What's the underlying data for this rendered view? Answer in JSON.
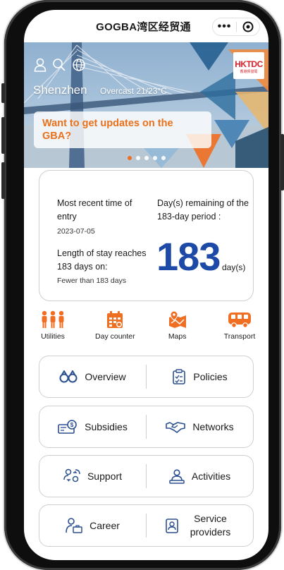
{
  "nav": {
    "title": "GOGBA湾区经贸通",
    "more_label": "•••"
  },
  "banner": {
    "city": "Shenzhen",
    "weather": "Overcast  21/23°C",
    "promo_text": "Want to get updates on the GBA?",
    "brand_mark": "HKTDC",
    "brand_sub": "香港貿發局",
    "slide_count": 5,
    "active_slide": 1
  },
  "counter": {
    "entry_label": "Most recent time of entry",
    "entry_date": "2023-07-05",
    "length_label": "Length of stay reaches 183 days on:",
    "length_value": "Fewer than 183 days",
    "remaining_label": "Day(s) remaining of the 183-day period :",
    "remaining_days": "183",
    "remaining_unit": "day(s)"
  },
  "quick_links": [
    {
      "label": "Utilities",
      "icon": "people-icon"
    },
    {
      "label": "Day counter",
      "icon": "calendar-icon"
    },
    {
      "label": "Maps",
      "icon": "map-icon"
    },
    {
      "label": "Transport",
      "icon": "bus-icon"
    }
  ],
  "menu": [
    {
      "left": {
        "label": "Overview",
        "icon": "binoculars-icon"
      },
      "right": {
        "label": "Policies",
        "icon": "policy-document-icon"
      }
    },
    {
      "left": {
        "label": "Subsidies",
        "icon": "money-icon"
      },
      "right": {
        "label": "Networks",
        "icon": "handshake-icon"
      }
    },
    {
      "left": {
        "label": "Support",
        "icon": "support-people-icon"
      },
      "right": {
        "label": "Activities",
        "icon": "presenter-icon"
      }
    },
    {
      "left": {
        "label": "Career",
        "icon": "career-person-icon"
      },
      "right": {
        "label": "Service providers",
        "icon": "provider-card-icon"
      }
    }
  ],
  "colors": {
    "accent_orange": "#ef6e22",
    "number_blue": "#1d4aa7",
    "icon_blue": "#2a4f8f"
  }
}
